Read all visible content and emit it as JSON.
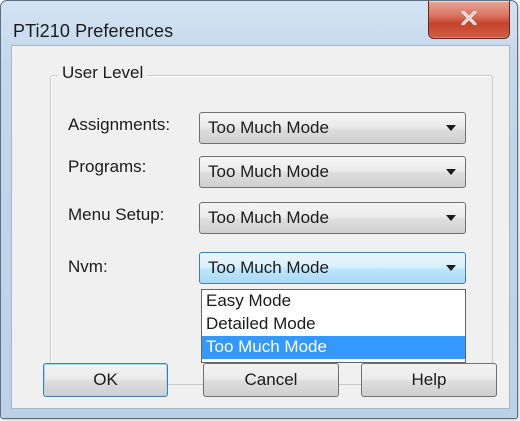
{
  "window": {
    "title": "PTi210 Preferences",
    "close_icon": "close-x-icon",
    "accent_close": "#c5442c"
  },
  "group": {
    "legend": "User Level"
  },
  "rows": [
    {
      "label": "Assignments:",
      "value": "Too Much Mode"
    },
    {
      "label": "Programs:",
      "value": "Too Much Mode"
    },
    {
      "label": "Menu Setup:",
      "value": "Too Much Mode"
    },
    {
      "label": "Nvm:",
      "value": "Too Much Mode"
    }
  ],
  "dropdown": {
    "options": [
      "Easy Mode",
      "Detailed Mode",
      "Too Much Mode"
    ],
    "selected": "Too Much Mode",
    "highlight_color": "#3399ff"
  },
  "buttons": {
    "ok": "OK",
    "cancel": "Cancel",
    "help": "Help"
  }
}
